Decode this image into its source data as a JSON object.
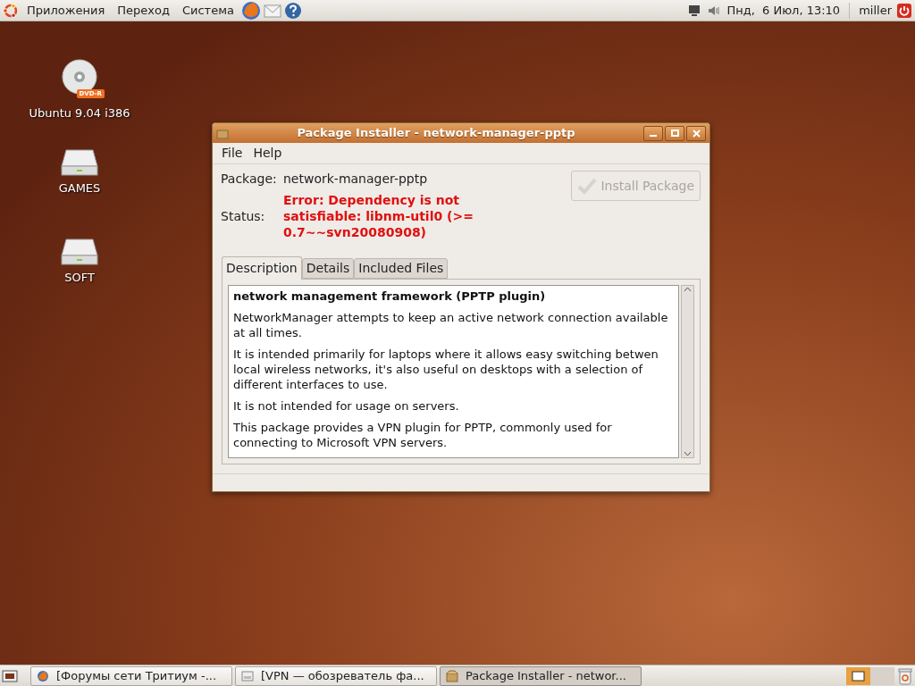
{
  "top_panel": {
    "menus": [
      "Приложения",
      "Переход",
      "Система"
    ],
    "clock": "Пнд,  6 Июл, 13:10",
    "user": "miller"
  },
  "desktop_icons": [
    {
      "kind": "dvd",
      "label": "Ubuntu 9.04 i386",
      "badge": "DVD-R"
    },
    {
      "kind": "drive",
      "label": "GAMES"
    },
    {
      "kind": "drive",
      "label": "SOFT"
    }
  ],
  "window": {
    "title": "Package Installer - network-manager-pptp",
    "menu": [
      "File",
      "Help"
    ],
    "package_label": "Package:",
    "package": "network-manager-pptp",
    "status_label": "Status:",
    "status": "Error: Dependency is not satisfiable: libnm-util0 (>= 0.7~~svn20080908)",
    "install_button": {
      "label": "Install Package",
      "disabled": true
    },
    "tabs": [
      {
        "label": "Description",
        "selected": true
      },
      {
        "label": "Details",
        "selected": false
      },
      {
        "label": "Included Files",
        "selected": false
      }
    ],
    "description": {
      "heading": "network management framework (PPTP plugin)",
      "paragraphs": [
        "NetworkManager attempts to keep an active network connection available at all times.",
        "It is intended primarily for laptops where it allows easy switching betwen local wireless networks, it's also useful on desktops with a selection of different interfaces to use.",
        "It is not intended for usage on servers.",
        "This package provides a VPN plugin for PPTP, commonly used for connecting to Microsoft VPN servers."
      ]
    }
  },
  "taskbar": [
    {
      "kind": "browser",
      "label": "[Форумы сети Тритиум -...",
      "selected": false
    },
    {
      "kind": "files",
      "label": "[VPN — обозреватель фа...",
      "selected": false
    },
    {
      "kind": "package",
      "label": "Package Installer - networ...",
      "selected": true
    }
  ]
}
